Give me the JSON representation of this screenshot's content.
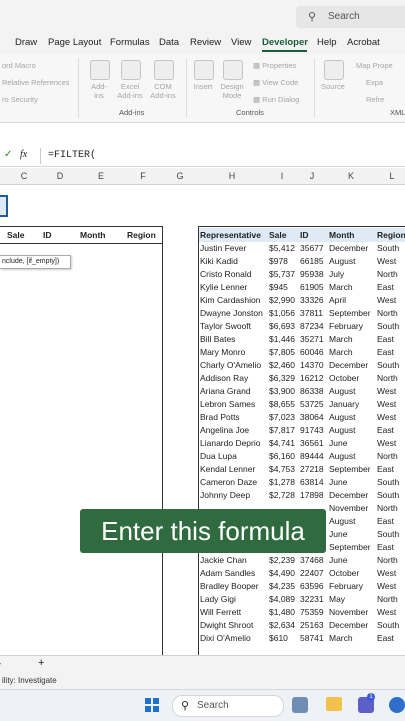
{
  "search": {
    "label": "Search"
  },
  "menu": {
    "items": [
      "Draw",
      "Page Layout",
      "Formulas",
      "Data",
      "Review",
      "View",
      "Developer",
      "Help",
      "Acrobat"
    ]
  },
  "ribbon": {
    "macro_items": [
      "ord Macro",
      "Relative References",
      "ro Security"
    ],
    "addins_buttons": [
      "Add-\nins",
      "Excel\nAdd-ins",
      "COM\nAdd-ins"
    ],
    "addins_group": "Add-ins",
    "control_buttons": [
      "Insert",
      "Design\nMode"
    ],
    "control_small": [
      "Properties",
      "View Code",
      "Run Dialog"
    ],
    "controls_group": "Controls",
    "source_button": "Source",
    "xml_small": [
      "Map Prope",
      "Expa",
      "Refre"
    ],
    "xml_group": "XML"
  },
  "formula": {
    "fx": "fx",
    "text": "=FILTER("
  },
  "columns": [
    "C",
    "D",
    "E",
    "F",
    "G",
    "H",
    "I",
    "J",
    "K",
    "L"
  ],
  "left_table": {
    "headers": [
      "Sale",
      "ID",
      "Month",
      "Region"
    ],
    "tooltip": "nclude, [if_empty])"
  },
  "right_table": {
    "headers": [
      "Representative",
      "Sale",
      "ID",
      "Month",
      "Region"
    ],
    "rows": [
      [
        "Justin Fever",
        "$5,412",
        "35677",
        "December",
        "South"
      ],
      [
        "Kiki Kadid",
        "$978",
        "66185",
        "August",
        "West"
      ],
      [
        "Cristo Ronald",
        "$5,737",
        "95938",
        "July",
        "North"
      ],
      [
        "Kylie Lenner",
        "$945",
        "61905",
        "March",
        "East"
      ],
      [
        "Kim Cardashion",
        "$2,990",
        "33326",
        "April",
        "West"
      ],
      [
        "Dwayne Jonston",
        "$1,056",
        "37811",
        "September",
        "North"
      ],
      [
        "Taylor Swooft",
        "$6,693",
        "87234",
        "February",
        "South"
      ],
      [
        "Bill Bates",
        "$1,446",
        "35271",
        "March",
        "East"
      ],
      [
        "Mary Monro",
        "$7,805",
        "60046",
        "March",
        "East"
      ],
      [
        "Charly O'Amelio",
        "$2,460",
        "14370",
        "December",
        "South"
      ],
      [
        "Addison Ray",
        "$6,329",
        "16212",
        "October",
        "North"
      ],
      [
        "Ariana Grand",
        "$3,900",
        "86338",
        "August",
        "West"
      ],
      [
        "Lebron Sames",
        "$8,655",
        "53725",
        "January",
        "West"
      ],
      [
        "Brad Potts",
        "$7,023",
        "38064",
        "August",
        "West"
      ],
      [
        "Angelina Joe",
        "$7,817",
        "91743",
        "August",
        "East"
      ],
      [
        "Lianardo Deprio",
        "$4,741",
        "36561",
        "June",
        "West"
      ],
      [
        "Dua Lupa",
        "$6,160",
        "89444",
        "August",
        "North"
      ],
      [
        "Kendal Lenner",
        "$4,753",
        "27218",
        "September",
        "East"
      ],
      [
        "Cameron Daze",
        "$1,278",
        "63814",
        "June",
        "South"
      ],
      [
        "Johnny Deep",
        "$2,728",
        "17898",
        "December",
        "South"
      ],
      [
        "",
        "",
        "",
        "November",
        "North"
      ],
      [
        "",
        "",
        "",
        "August",
        "East"
      ],
      [
        "",
        "",
        "",
        "June",
        "South"
      ],
      [
        "",
        "",
        "",
        "September",
        "East"
      ],
      [
        "Jackie Chan",
        "$2,239",
        "37468",
        "June",
        "North"
      ],
      [
        "Adam Sandles",
        "$4,490",
        "22407",
        "October",
        "West"
      ],
      [
        "Bradley Booper",
        "$4,235",
        "63596",
        "February",
        "West"
      ],
      [
        "Lady Gigi",
        "$4,089",
        "32231",
        "May",
        "North"
      ],
      [
        "Will Ferrett",
        "$1,480",
        "75359",
        "November",
        "West"
      ],
      [
        "Dwight Shroot",
        "$2,634",
        "25163",
        "December",
        "South"
      ],
      [
        "Dixi O'Amelio",
        "$610",
        "58741",
        "March",
        "East"
      ]
    ]
  },
  "caption": "Enter this formula",
  "status": {
    "text": "ility: Investigate"
  },
  "sheetbar": {
    "add": "+"
  },
  "taskbar": {
    "search": "Search"
  }
}
